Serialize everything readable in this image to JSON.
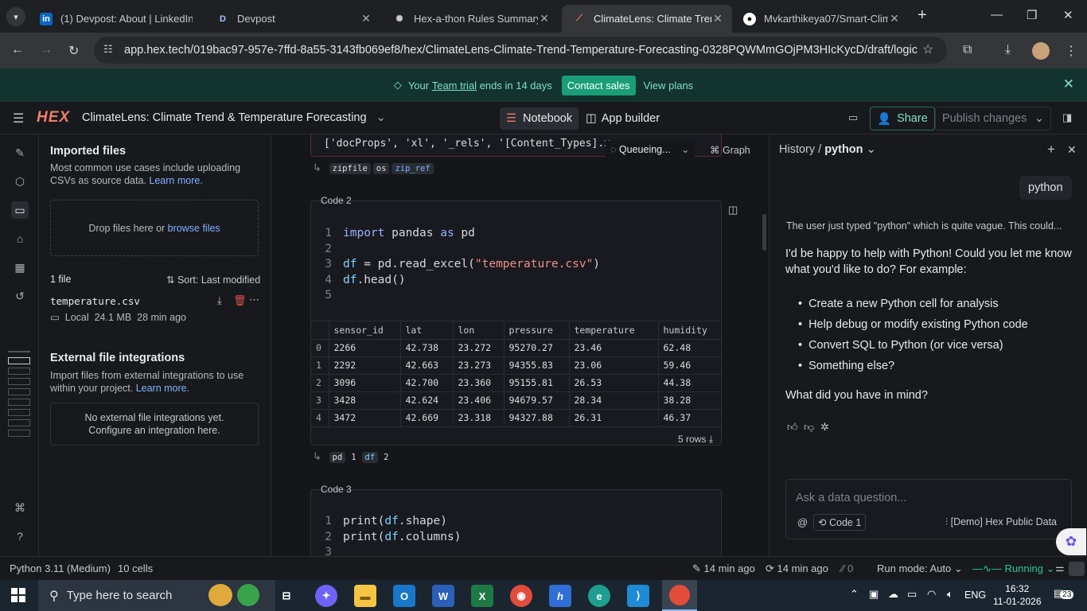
{
  "browser": {
    "tabs": [
      {
        "title": "(1) Devpost: About | LinkedIn",
        "icon": "linkedin-icon"
      },
      {
        "title": "Devpost",
        "icon": "devpost-icon"
      },
      {
        "title": "Hex-a-thon Rules Summary",
        "icon": "openai-icon"
      },
      {
        "title": "ClimateLens: Climate Trend &",
        "icon": "hex-icon",
        "active": true
      },
      {
        "title": "Mvkarthikeya07/Smart-Clim",
        "icon": "github-icon"
      }
    ],
    "url": "app.hex.tech/019bac97-957e-7ffd-8a55-3143fb069ef8/hex/ClimateLens-Climate-Trend-Temperature-Forecasting-0328PQWMmGOjPM3HIcKycD/draft/logic"
  },
  "banner": {
    "prefix": "Your",
    "team": "Team trial",
    "suffix": "ends in 14 days",
    "contact": "Contact sales",
    "plans": "View plans"
  },
  "header": {
    "logo": "HEX",
    "project_title": "ClimateLens: Climate Trend & Temperature Forecasting",
    "notebook": "Notebook",
    "app_builder": "App builder",
    "share": "Share",
    "publish": "Publish changes"
  },
  "files": {
    "title": "Imported files",
    "desc": "Most common use cases include uploading CSVs as source data.",
    "learn": "Learn more.",
    "drop": "Drop files here or",
    "browse": "browse files",
    "count": "1 file",
    "sort": "Sort: Last modified",
    "file": {
      "name": "temperature.csv",
      "location": "Local",
      "size": "24.1 MB",
      "time": "28 min ago"
    },
    "ext_title": "External file integrations",
    "ext_desc": "Import files from external integrations to use within your project.",
    "ext_learn": "Learn more.",
    "ext_empty1": "No external file integrations yet.",
    "ext_empty2": "Configure an integration here."
  },
  "notebook": {
    "prev_output": "['docProps', 'xl', '_rels', '[Content_Types].x",
    "queueing": "Queueing...",
    "graph": "Graph",
    "prev_chips": [
      "zipfile",
      "os",
      "zip_ref"
    ],
    "code2": {
      "title": "Code 2",
      "lines": [
        "import pandas as pd",
        "",
        "df = pd.read_excel(\"temperature.csv\")",
        "df.head()",
        ""
      ],
      "columns": [
        "",
        "sensor_id",
        "lat",
        "lon",
        "pressure",
        "temperature",
        "humidity"
      ],
      "rows": [
        [
          "0",
          "2266",
          "42.738",
          "23.272",
          "95270.27",
          "23.46",
          "62.48"
        ],
        [
          "1",
          "2292",
          "42.663",
          "23.273",
          "94355.83",
          "23.06",
          "59.46"
        ],
        [
          "2",
          "3096",
          "42.700",
          "23.360",
          "95155.81",
          "26.53",
          "44.38"
        ],
        [
          "3",
          "3428",
          "42.624",
          "23.406",
          "94679.57",
          "28.34",
          "38.28"
        ],
        [
          "4",
          "3472",
          "42.669",
          "23.318",
          "94327.88",
          "26.31",
          "46.37"
        ]
      ],
      "row_count": "5 rows",
      "chips": [
        "pd",
        "1",
        "df",
        "2"
      ]
    },
    "code3": {
      "title": "Code 3",
      "lines": [
        "print(df.shape)",
        "print(df.columns)",
        ""
      ]
    }
  },
  "ai": {
    "history": "History /",
    "thread": "python",
    "user_msg": "python",
    "thinking": "The user just typed \"python\" which is quite vague. This could...",
    "intro": "I'd be happy to help with Python! Could you let me know what you'd like to do? For example:",
    "bullets": [
      "Create a new Python cell for analysis",
      "Help debug or modify existing Python code",
      "Convert SQL to Python (or vice versa)",
      "Something else?"
    ],
    "question": "What did you have in mind?",
    "input_placeholder": "Ask a data question...",
    "context": "Code 1",
    "source": "[Demo] Hex Public Data"
  },
  "status": {
    "kernel": "Python 3.11 (Medium)",
    "cells": "10 cells",
    "edited": "14 min ago",
    "run": "14 min ago",
    "zero": "0",
    "run_mode": "Run mode: Auto",
    "running": "Running"
  },
  "taskbar": {
    "search": "Type here to search",
    "lang": "ENG",
    "time": "16:32",
    "date": "11-01-2026",
    "notif": "23"
  },
  "colors": {
    "accent": "#1a9e77",
    "hex_logo": "#f07d6c",
    "link": "#7fb3ff",
    "running": "#2fc79a"
  }
}
